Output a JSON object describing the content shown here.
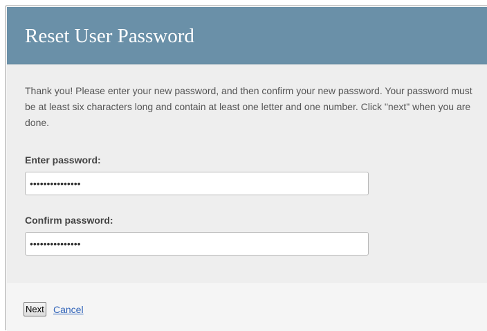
{
  "header": {
    "title": "Reset User Password"
  },
  "form": {
    "intro_text": "Thank you! Please enter your new password, and then confirm your new password. Your password must be at least six characters long and contain at least one letter and one number. Click \"next\" when you are done.",
    "password": {
      "label": "Enter password:",
      "value": "•••••••••••••••"
    },
    "confirm_password": {
      "label": "Confirm password:",
      "value": "•••••••••••••••"
    }
  },
  "footer": {
    "next_label": "Next",
    "cancel_label": "Cancel"
  },
  "colors": {
    "header_bg": "#6a90a8",
    "content_bg": "#eeeeee",
    "link": "#2f62b8"
  }
}
